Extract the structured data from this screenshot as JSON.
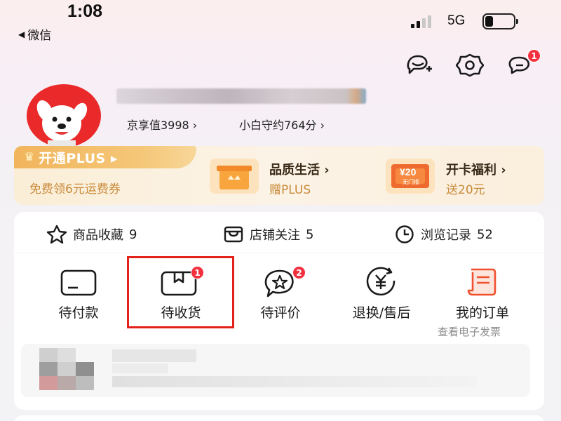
{
  "status_bar": {
    "time": "1:08",
    "back_app": "微信",
    "network": "5G",
    "battery_level_percent": 20
  },
  "header": {
    "icons": [
      "add-friend-icon",
      "settings-icon",
      "message-icon"
    ],
    "message_badge": "1"
  },
  "profile": {
    "avatar": "jd-dog-mascot-avatar",
    "stats": [
      {
        "label": "京享值3998 ›"
      },
      {
        "label": "小白守约764分 ›"
      }
    ]
  },
  "plus": {
    "tag": "开通PLUS ▸",
    "subtitle": "免费领6元运费券",
    "perks": [
      {
        "title": "品质生活 ›",
        "sub": "赠PLUS",
        "icon": "gift-box-icon"
      },
      {
        "title": "开卡福利 ›",
        "sub": "送20元",
        "icon": "coupon-icon",
        "coupon_amount": "¥20",
        "coupon_note": "无门槛"
      }
    ]
  },
  "favorites": [
    {
      "label": "商品收藏",
      "count": "9",
      "icon": "star-icon"
    },
    {
      "label": "店铺关注",
      "count": "5",
      "icon": "store-icon"
    },
    {
      "label": "浏览记录",
      "count": "52",
      "icon": "clock-icon"
    }
  ],
  "orders": [
    {
      "label": "待付款",
      "icon": "card-icon",
      "badge": ""
    },
    {
      "label": "待收货",
      "icon": "package-icon",
      "badge": "1"
    },
    {
      "label": "待评价",
      "icon": "review-icon",
      "badge": "2"
    },
    {
      "label": "退换/售后",
      "icon": "refund-icon",
      "badge": ""
    },
    {
      "label": "我的订单",
      "icon": "order-list-icon",
      "badge": "",
      "sub": "查看电子发票"
    }
  ],
  "colors": {
    "brand_red": "#e3221a",
    "badge_red": "#f2303e",
    "plus_gold": "#f1b55c",
    "perk_orange": "#c98a3a"
  }
}
